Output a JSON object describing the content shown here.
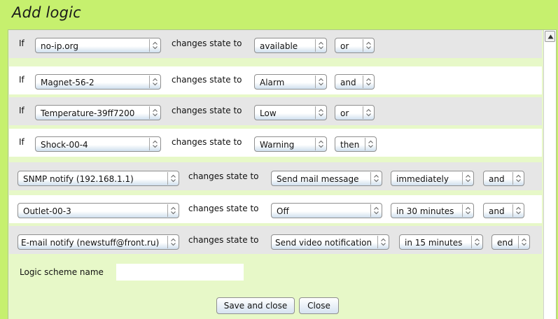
{
  "window": {
    "title": "Add logic"
  },
  "conditions": [
    {
      "prefix": "If",
      "device": "no-ip.org",
      "verb": "changes state to",
      "state": "available",
      "connector": "or"
    },
    {
      "prefix": "If",
      "device": "Magnet-56-2",
      "verb": "changes state to",
      "state": "Alarm",
      "connector": "and"
    },
    {
      "prefix": "If",
      "device": "Temperature-39ff7200",
      "verb": "changes state to",
      "state": "Low",
      "connector": "or"
    },
    {
      "prefix": "If",
      "device": "Shock-00-4",
      "verb": "changes state to",
      "state": "Warning",
      "connector": "then"
    }
  ],
  "actions": [
    {
      "device": "SNMP notify (192.168.1.1)",
      "verb": "changes state to",
      "state": "Send mail message",
      "delay": "immediately",
      "connector": "and"
    },
    {
      "device": "Outlet-00-3",
      "verb": "changes state to",
      "state": "Off",
      "delay": "in 30 minutes",
      "connector": "and"
    },
    {
      "device": "E-mail notify (newstuff@front.ru)",
      "verb": "changes state to",
      "state": "Send video notification",
      "delay": "in 15 minutes",
      "connector": "end"
    }
  ],
  "scheme": {
    "label": "Logic scheme name",
    "value": ""
  },
  "buttons": {
    "save": "Save and close",
    "close": "Close"
  },
  "icons": {
    "select_arrow": "up-down-chevron-icon",
    "scroll_up": "triangle-up-icon"
  }
}
